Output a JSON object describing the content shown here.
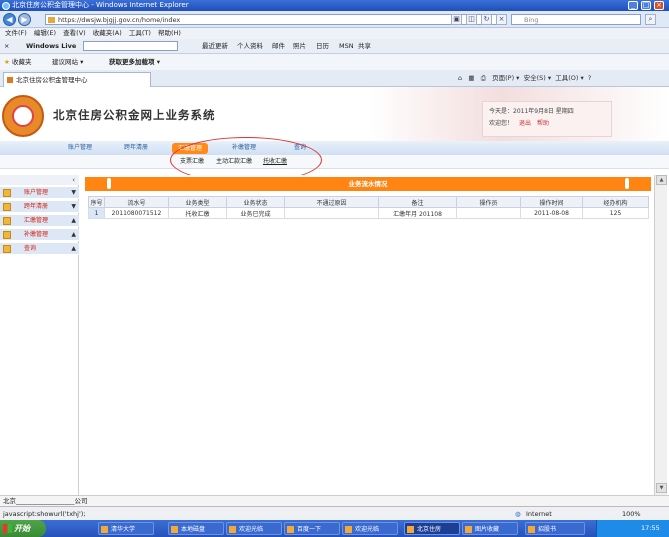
{
  "window": {
    "title": "北京住房公积金管理中心 - Windows Internet Explorer"
  },
  "address": {
    "url": "https://dwsjw.bjgjj.gov.cn/home/index",
    "search_placeholder": "Bing"
  },
  "menu": [
    "文件(F)",
    "编辑(E)",
    "查看(V)",
    "收藏夹(A)",
    "工具(T)",
    "帮助(H)"
  ],
  "livebar": {
    "brand": "Windows Live",
    "items": [
      "最近更新",
      "个人资料",
      "邮件",
      "照片",
      "日历",
      "MSN",
      "共享"
    ]
  },
  "favbar": {
    "favorites": "收藏夹",
    "suggested": "建议网站 ▾",
    "more": "获取更多加载项 ▾"
  },
  "tab": {
    "title": "北京住房公积金管理中心"
  },
  "tabtools": {
    "page": "页面(P) ▾",
    "safety": "安全(S) ▾",
    "tools": "工具(O) ▾"
  },
  "header": {
    "site_title": "北京住房公积金网上业务系统",
    "welcome_line1": "今天是：2011年9月8日 星期四",
    "welcome_line2": "欢迎您！",
    "logout": "退出",
    "help": "帮助"
  },
  "mainnav": [
    "账户管理",
    "跨年清册",
    "汇缴管理",
    "补缴管理",
    "查询"
  ],
  "subnav": [
    "支票汇缴",
    "主动汇款汇缴",
    "托收汇缴"
  ],
  "sidebar": [
    "账户管理",
    "跨年清册",
    "汇缴管理",
    "补缴管理",
    "查询"
  ],
  "panel": {
    "title": "业务流水情况"
  },
  "table": {
    "headers": [
      "序号",
      "流水号",
      "业务类型",
      "业务状态",
      "不通过原因",
      "备注",
      "操作员",
      "操作时间",
      "经办机构"
    ],
    "rows": [
      [
        "1",
        "2011080071512",
        "托收汇缴",
        "业务已完成",
        "",
        "汇缴年月 201108",
        "",
        "2011-08-08",
        "125"
      ]
    ]
  },
  "status": {
    "left": "北京__________________公司",
    "script": "javascript:showurl('txhj');",
    "zone": "Internet",
    "zoom": "100%"
  },
  "taskbar": {
    "start": "开始",
    "buttons": [
      "清华大学",
      "本地磁盘",
      "欢迎光临",
      "百度一下",
      "欢迎光临",
      "北京住房",
      "图片收藏",
      "招股书"
    ],
    "time": "17:55"
  }
}
